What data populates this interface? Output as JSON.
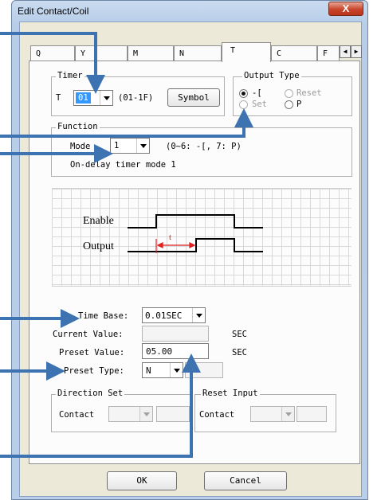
{
  "window": {
    "title": "Edit Contact/Coil",
    "close_glyph": "X"
  },
  "tabs": [
    {
      "label": "Q"
    },
    {
      "label": "Y"
    },
    {
      "label": "M"
    },
    {
      "label": "N"
    },
    {
      "label": "T",
      "active": true
    },
    {
      "label": "C"
    },
    {
      "label": "F"
    }
  ],
  "tab_scroll": {
    "left": "◀",
    "right": "▶"
  },
  "timer": {
    "group_label": "Timer",
    "prefix": "T",
    "selected": "01",
    "range": "(01-1F)",
    "symbol_button": "Symbol"
  },
  "output_type": {
    "group_label": "Output Type",
    "options": [
      {
        "label": "-[",
        "selected": true,
        "enabled": true
      },
      {
        "label": "Reset",
        "selected": false,
        "enabled": false
      },
      {
        "label": "Set",
        "selected": false,
        "enabled": false
      },
      {
        "label": "P",
        "selected": false,
        "enabled": true
      }
    ]
  },
  "function": {
    "group_label": "Function",
    "mode_label": "Mode",
    "mode_value": "1",
    "mode_hint": "(0~6: -[, 7: P)",
    "description": "On-delay timer mode 1"
  },
  "diagram": {
    "enable_label": "Enable",
    "output_label": "Output",
    "delay_label": "t"
  },
  "settings": {
    "time_base_label": "Time Base:",
    "time_base_value": "0.01SEC",
    "current_value_label": "Current Value:",
    "current_value": "",
    "current_unit": "SEC",
    "preset_value_label": "Preset Value:",
    "preset_value": "05.00",
    "preset_unit": "SEC",
    "preset_type_label": "Preset Type:",
    "preset_type_value": "N"
  },
  "direction_set": {
    "group_label": "Direction Set",
    "contact_label": "Contact"
  },
  "reset_input": {
    "group_label": "Reset Input",
    "contact_label": "Contact"
  },
  "buttons": {
    "ok": "OK",
    "cancel": "Cancel"
  },
  "colors": {
    "annotation_arrow": "#3d73b0",
    "title_bar": "#bcd1ea",
    "close_button": "#c8452b"
  }
}
